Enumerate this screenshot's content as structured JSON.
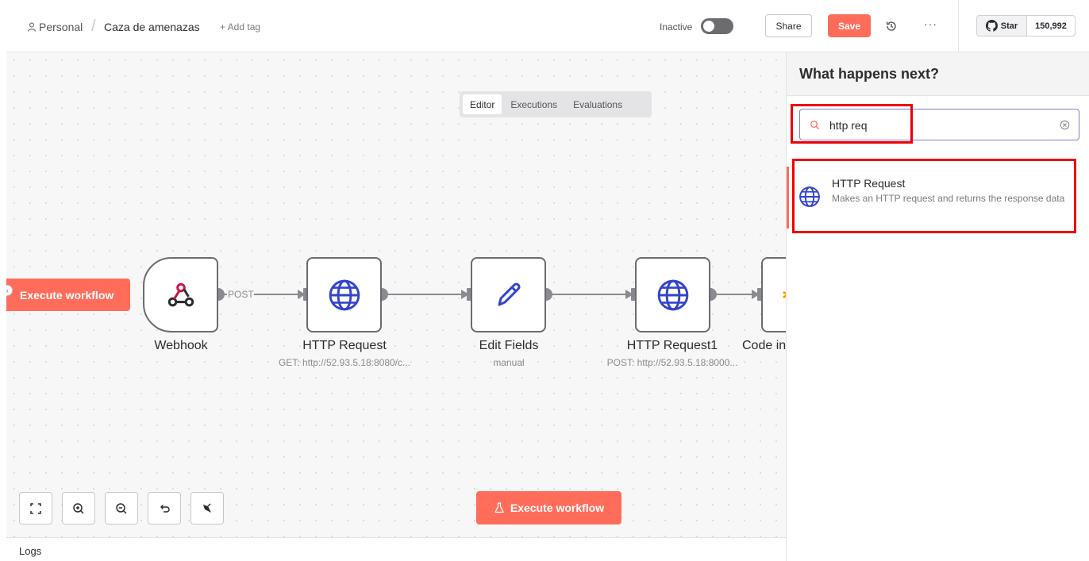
{
  "header": {
    "breadcrumb_project": "Personal",
    "breadcrumb_separator": "/",
    "workflow_name": "Caza de amenazas",
    "add_tag_label": "+ Add tag",
    "active_toggle_label": "Inactive",
    "share_label": "Share",
    "save_label": "Save",
    "more_label": "···",
    "github_star_label": "Star",
    "github_star_count": "150,992"
  },
  "tabs": [
    {
      "label": "Editor",
      "active": true
    },
    {
      "label": "Executions",
      "active": false
    },
    {
      "label": "Evaluations",
      "active": false
    }
  ],
  "canvas": {
    "execute_left_label": "Execute workflow",
    "execute_bottom_label": "Execute workflow",
    "connection_label": "POST",
    "nodes": [
      {
        "title": "Webhook",
        "subtitle": "",
        "icon": "webhook-icon"
      },
      {
        "title": "HTTP Request",
        "subtitle": "GET: http://52.93.5.18:8080/c...",
        "icon": "globe-icon"
      },
      {
        "title": "Edit Fields",
        "subtitle": "manual",
        "icon": "pencil-icon"
      },
      {
        "title": "HTTP Request1",
        "subtitle": "POST: http://52.93.5.18:8000...",
        "icon": "globe-icon"
      },
      {
        "title": "Code in",
        "subtitle": "",
        "icon": "code-icon"
      }
    ],
    "controls": [
      "fit-view-icon",
      "zoom-in-icon",
      "zoom-out-icon",
      "undo-icon",
      "tidy-up-icon"
    ]
  },
  "logs": {
    "label": "Logs"
  },
  "panel": {
    "title": "What happens next?",
    "search_value": "http req",
    "result": {
      "title": "HTTP Request",
      "description": "Makes an HTTP request and returns the response data",
      "icon": "globe-icon"
    }
  },
  "colors": {
    "accent": "#ff6d5a",
    "node_icon": "#3344cc",
    "highlight": "#ee0000"
  }
}
